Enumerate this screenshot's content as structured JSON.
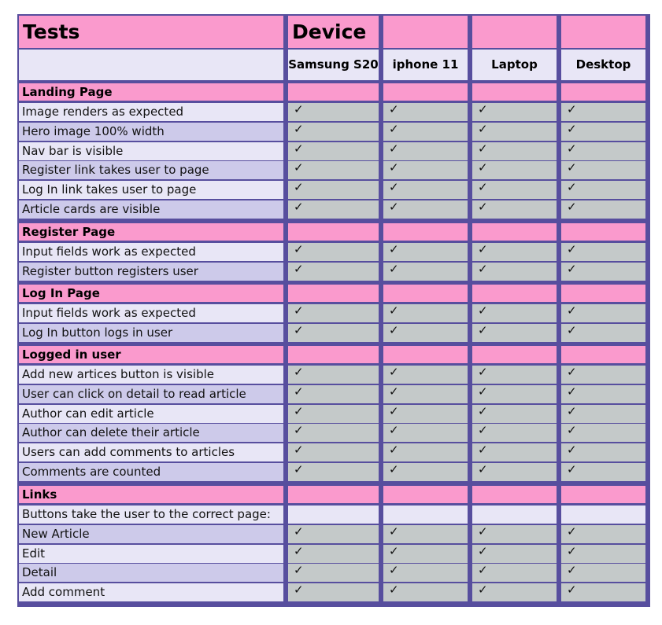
{
  "header": {
    "tests_label": "Tests",
    "device_label": "Device"
  },
  "devices": [
    "Samsung S20",
    "iphone 11",
    "Laptop",
    "Desktop"
  ],
  "check_mark": "✓",
  "sections": [
    {
      "title": "Landing Page",
      "rows": [
        {
          "label": "Image renders as expected",
          "checks": [
            true,
            true,
            true,
            true
          ]
        },
        {
          "label": "Hero image 100% width",
          "checks": [
            true,
            true,
            true,
            true
          ]
        },
        {
          "label": "Nav bar is visible",
          "checks": [
            true,
            true,
            true,
            true
          ]
        },
        {
          "label": "Register link takes user to page",
          "checks": [
            true,
            true,
            true,
            true
          ]
        },
        {
          "label": "Log In link takes user to page",
          "checks": [
            true,
            true,
            true,
            true
          ]
        },
        {
          "label": "Article cards are visible",
          "checks": [
            true,
            true,
            true,
            true
          ]
        }
      ]
    },
    {
      "title": "Register Page",
      "rows": [
        {
          "label": "Input fields work as expected",
          "checks": [
            true,
            true,
            true,
            true
          ]
        },
        {
          "label": "Register button registers user",
          "checks": [
            true,
            true,
            true,
            true
          ]
        }
      ]
    },
    {
      "title": "Log In Page",
      "rows": [
        {
          "label": "Input fields work as expected",
          "checks": [
            true,
            true,
            true,
            true
          ]
        },
        {
          "label": "Log In button logs in user",
          "checks": [
            true,
            true,
            true,
            true
          ]
        }
      ]
    },
    {
      "title": "Logged in user",
      "rows": [
        {
          "label": "Add new artices button is visible",
          "checks": [
            true,
            true,
            true,
            true
          ]
        },
        {
          "label": "User can click on detail to read article",
          "checks": [
            true,
            true,
            true,
            true
          ]
        },
        {
          "label": "Author can edit article",
          "checks": [
            true,
            true,
            true,
            true
          ]
        },
        {
          "label": "Author can delete their article",
          "checks": [
            true,
            true,
            true,
            true
          ]
        },
        {
          "label": "Users can add comments to articles",
          "checks": [
            true,
            true,
            true,
            true
          ]
        },
        {
          "label": "Comments are counted",
          "checks": [
            true,
            true,
            true,
            true
          ]
        }
      ]
    },
    {
      "title": "Links",
      "rows": [
        {
          "label": "Buttons take the user to the correct page:",
          "checks": [
            false,
            false,
            false,
            false
          ]
        },
        {
          "label": "New Article",
          "checks": [
            true,
            true,
            true,
            true
          ]
        },
        {
          "label": "Edit",
          "checks": [
            true,
            true,
            true,
            true
          ]
        },
        {
          "label": "Detail",
          "checks": [
            true,
            true,
            true,
            true
          ]
        },
        {
          "label": "Add comment",
          "checks": [
            true,
            true,
            true,
            true
          ]
        }
      ]
    }
  ]
}
